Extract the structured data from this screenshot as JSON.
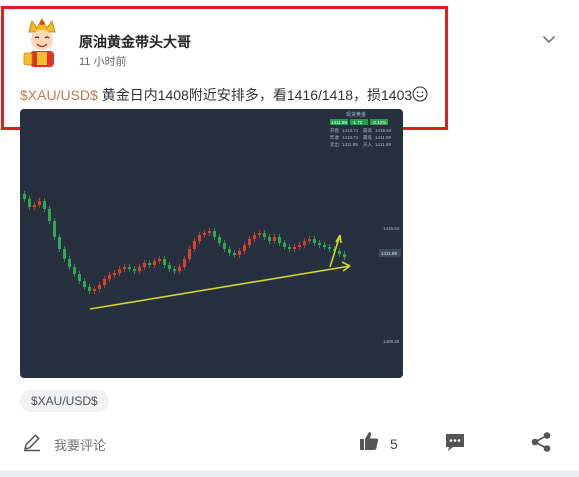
{
  "post": {
    "author": "原油黄金带头大哥",
    "time": "11 小时前",
    "ticker": "$XAU/USD$",
    "text": "黄金日内1408附近安排多，看1416/1418，损1403"
  },
  "chart_panel": {
    "title": "现货黄金",
    "rows": [
      [
        "1411.99",
        "-1.72",
        "-0.12%"
      ],
      [
        "开盘",
        "1413.71",
        "最高",
        "1415.64"
      ],
      [
        "昨收",
        "1413.71",
        "最低",
        "1411.09"
      ],
      [
        "卖出",
        "1411.99",
        "买入",
        "1411.99"
      ]
    ],
    "price_axis": [
      "1415.64",
      "1411.99",
      "1408.45"
    ],
    "colors": {
      "bg": "#26303f",
      "up": "#d9412b",
      "down": "#2fa84f",
      "trend": "#d7d42e"
    }
  },
  "tag": {
    "label": "$XAU/USD$"
  },
  "footer": {
    "comment_label": "我要评论",
    "like_count": "5"
  },
  "icons": {
    "menu": "chevron-down-icon",
    "comment": "edit-icon",
    "like": "thumbs-up-icon",
    "chat": "chat-bubble-icon",
    "share": "share-icon"
  },
  "colors": {
    "highlight": "#e01c1c",
    "ticker": "#c47a4a"
  }
}
